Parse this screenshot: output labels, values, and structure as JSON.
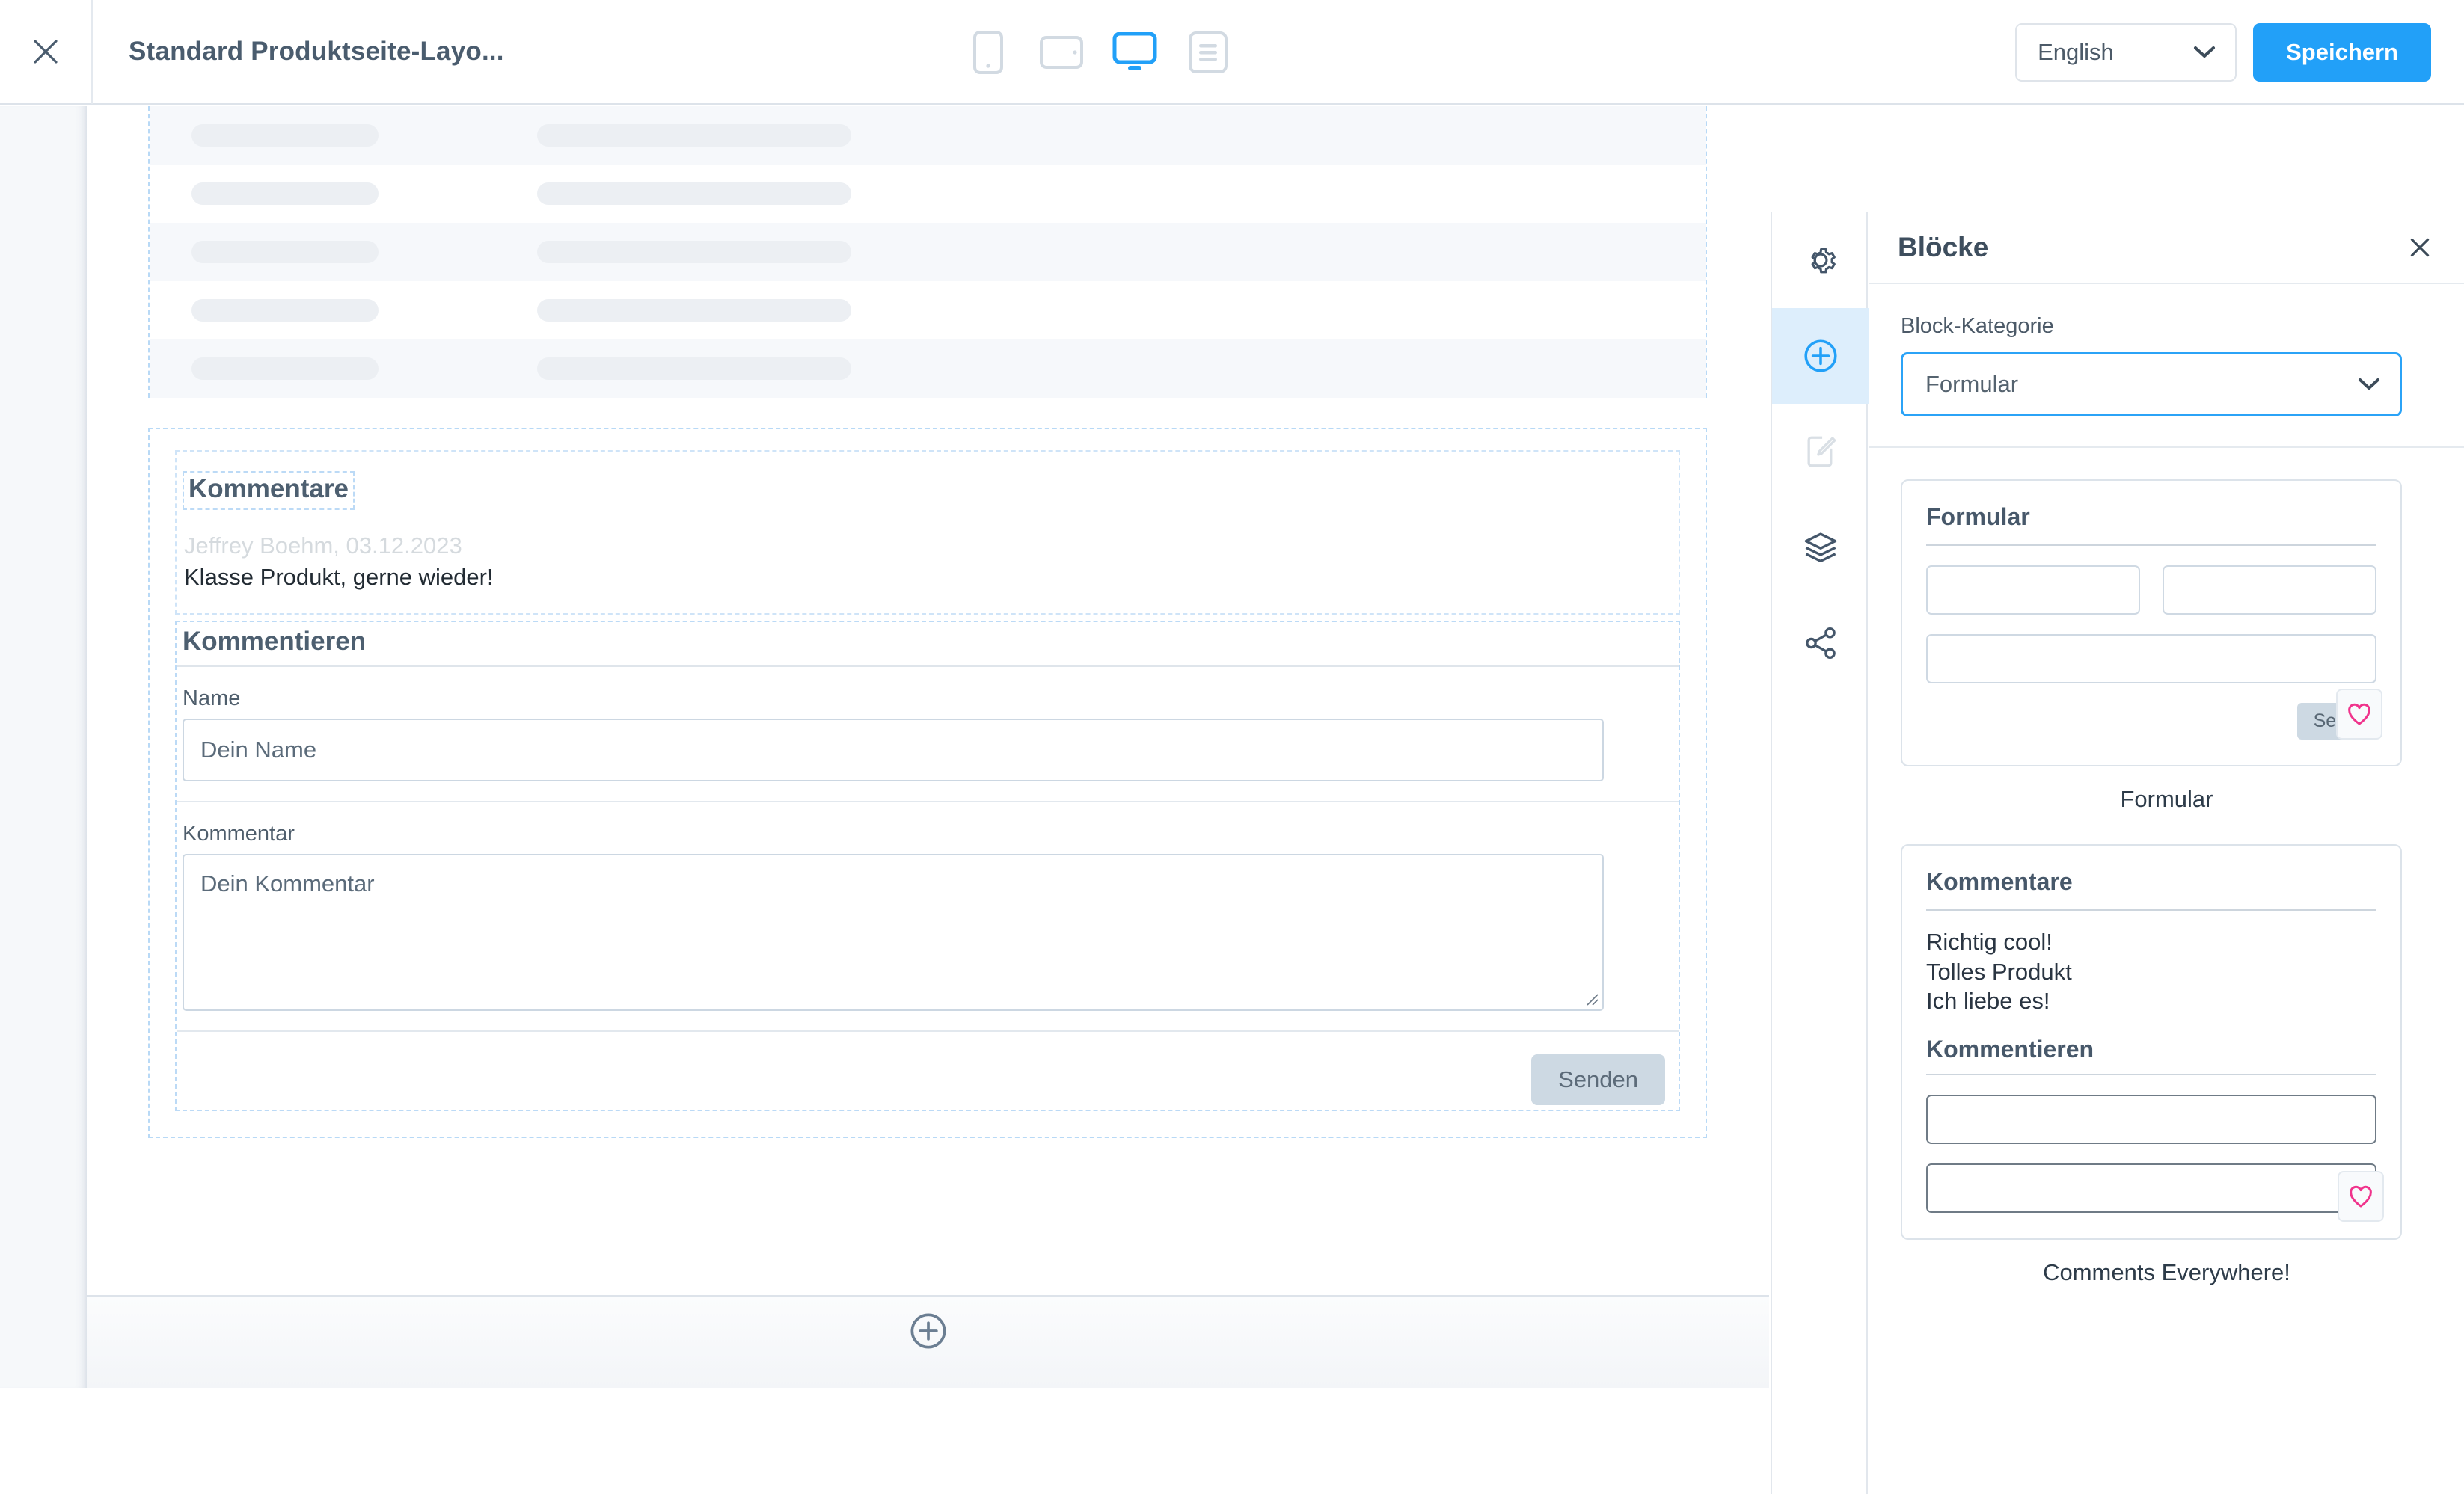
{
  "topbar": {
    "close_icon": "close-icon",
    "title": "Standard Produktseite-Layo...",
    "devices": [
      {
        "name": "mobile",
        "label": "Mobile",
        "active": false
      },
      {
        "name": "tablet",
        "label": "Tablet",
        "active": false
      },
      {
        "name": "desktop",
        "label": "Desktop",
        "active": true
      },
      {
        "name": "document",
        "label": "Document",
        "active": false
      }
    ],
    "language": "English",
    "save_label": "Speichern",
    "accent_color": "#22a0f8"
  },
  "canvas": {
    "skeleton": {
      "rows": [
        {
          "stripe": true
        },
        {
          "stripe": false
        },
        {
          "stripe": true
        },
        {
          "stripe": false
        },
        {
          "stripe": true
        }
      ]
    },
    "comments": {
      "heading": "Kommentare",
      "author": "Jeffrey Boehm, 03.12.2023",
      "text": "Klasse Produkt, gerne wieder!",
      "form_heading": "Kommentieren",
      "name_label": "Name",
      "name_placeholder": "Dein Name",
      "comment_label": "Kommentar",
      "comment_placeholder": "Dein Kommentar",
      "submit_label": "Senden"
    },
    "add_block_icon": "plus-circle-icon"
  },
  "rail": {
    "items": [
      {
        "name": "settings",
        "icon": "gear-icon",
        "active": false,
        "disabled": false
      },
      {
        "name": "add-block",
        "icon": "plus-circle-icon",
        "active": true,
        "disabled": false
      },
      {
        "name": "edit-content",
        "icon": "edit-document-icon",
        "active": false,
        "disabled": true
      },
      {
        "name": "layers",
        "icon": "layers-icon",
        "active": false,
        "disabled": false
      },
      {
        "name": "share",
        "icon": "share-icon",
        "active": false,
        "disabled": false
      }
    ]
  },
  "panel": {
    "title": "Blöcke",
    "close_icon": "close-icon",
    "category_label": "Block-Kategorie",
    "category_value": "Formular",
    "blocks": [
      {
        "card_title": "Formular",
        "caption": "Formular",
        "send_label": "Send",
        "favorite_icon": "heart-icon",
        "favorite_color": "#f0338c"
      },
      {
        "card_title": "Kommentare",
        "caption": "Comments Everywhere!",
        "comment_lines": [
          "Richtig cool!",
          "Tolles Produkt",
          "Ich liebe es!"
        ],
        "sub_title": "Kommentieren",
        "favorite_icon": "heart-icon",
        "favorite_color": "#f0338c"
      }
    ]
  }
}
